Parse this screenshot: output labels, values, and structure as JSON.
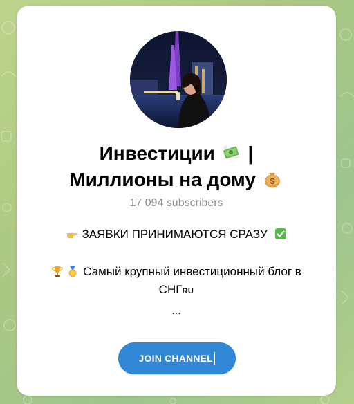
{
  "channel": {
    "title_line1": "Инвестиции",
    "title_sep": "|",
    "title_line2": "Миллионы на дому",
    "title_emoji_1": "money-with-wings-icon",
    "title_emoji_2": "money-bag-icon",
    "subscribers": "17 094 subscribers",
    "description": {
      "line1": "ЗАЯВКИ ПРИНИМАЮТСЯ СРАЗУ",
      "line1_left_icon": "pointing-hand-icon",
      "line1_right_icon": "check-mark-icon",
      "line2": "Самый крупный инвестиционный блог в",
      "line2_icons": [
        "trophy-icon",
        "medal-icon"
      ],
      "line3_main": "СНГ",
      "line3_sup": "RU",
      "more": "..."
    }
  },
  "join_button": {
    "label": "JOIN CHANNEL",
    "color": "#2f87d6"
  },
  "colors": {
    "background": "#a9c882",
    "card": "#ffffff",
    "muted_text": "#8a8f95"
  }
}
